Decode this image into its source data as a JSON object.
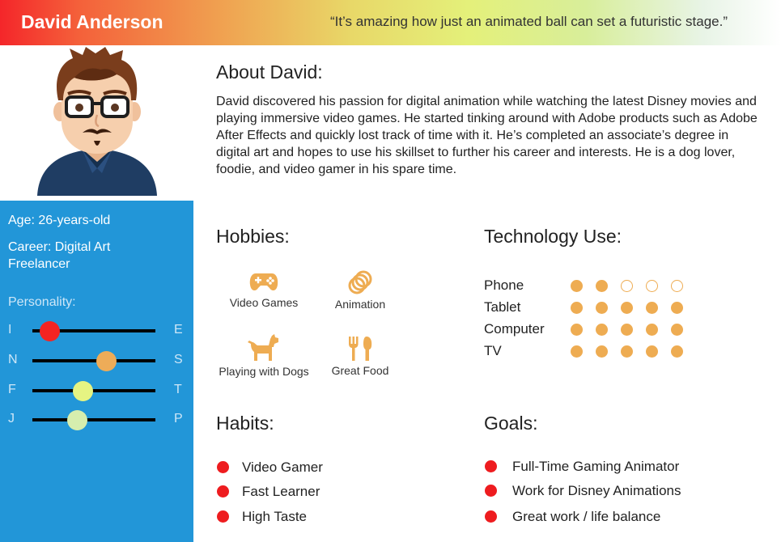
{
  "header": {
    "name": "David Anderson",
    "quote": "“It’s amazing how just an animated ball can set a futuristic stage.”"
  },
  "sidebar": {
    "age": "Age: 26-years-old",
    "career": "Career: Digital Art Freelancer",
    "personality_label": "Personality:",
    "traits": [
      {
        "left": "I",
        "right": "E",
        "value": 0.14,
        "color": "#f42422"
      },
      {
        "left": "N",
        "right": "S",
        "value": 0.6,
        "color": "#eeac58"
      },
      {
        "left": "F",
        "right": "T",
        "value": 0.41,
        "color": "#e6f482"
      },
      {
        "left": "J",
        "right": "P",
        "value": 0.36,
        "color": "#d6eeae"
      }
    ]
  },
  "about": {
    "title": "About David:",
    "text": "David discovered his passion for digital animation while watching the latest Disney movies and playing immersive video games. He started tinking around with Adobe products such as Adobe After Effects and quickly lost track of time with it. He’s completed an associate’s degree in digital art and hopes to use his skillset to further his career and interests. He is a dog lover, foodie, and video gamer in his spare time."
  },
  "hobbies": {
    "title": "Hobbies:",
    "items": [
      {
        "label": "Video Games",
        "icon": "gamepad-icon"
      },
      {
        "label": "Animation",
        "icon": "rings-icon"
      },
      {
        "label": "Playing with Dogs",
        "icon": "dog-icon"
      },
      {
        "label": "Great Food",
        "icon": "utensils-icon"
      }
    ]
  },
  "technology": {
    "title": "Technology Use:",
    "max": 5,
    "items": [
      {
        "label": "Phone",
        "level": 2
      },
      {
        "label": "Tablet",
        "level": 5
      },
      {
        "label": "Computer",
        "level": 5
      },
      {
        "label": "TV",
        "level": 5
      }
    ]
  },
  "habits": {
    "title": "Habits:",
    "items": [
      "Video Gamer",
      "Fast Learner",
      "High Taste"
    ]
  },
  "goals": {
    "title": "Goals:",
    "items": [
      "Full-Time Gaming Animator",
      "Work for Disney Animations",
      "Great work / life balance"
    ]
  },
  "colors": {
    "accent_orange": "#eeac52",
    "sidebar_blue": "#2296d8",
    "bullet_red": "#ee1c1f"
  }
}
